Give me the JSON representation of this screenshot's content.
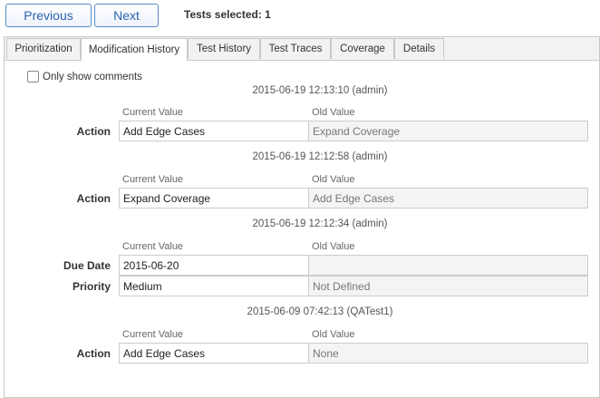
{
  "toolbar": {
    "previous_label": "Previous",
    "next_label": "Next",
    "selected_text": "Tests selected: 1"
  },
  "tabs": [
    {
      "label": "Prioritization",
      "active": false
    },
    {
      "label": "Modification History",
      "active": true
    },
    {
      "label": "Test History",
      "active": false
    },
    {
      "label": "Test Traces",
      "active": false
    },
    {
      "label": "Coverage",
      "active": false
    },
    {
      "label": "Details",
      "active": false
    }
  ],
  "filter": {
    "only_comments_label": "Only show comments",
    "checked": false
  },
  "columns": {
    "current": "Current Value",
    "old": "Old Value"
  },
  "entries": [
    {
      "timestamp": "2015-06-19 12:13:10 (admin)",
      "rows": [
        {
          "field": "Action",
          "current": "Add Edge Cases",
          "old": "Expand Coverage"
        }
      ]
    },
    {
      "timestamp": "2015-06-19 12:12:58 (admin)",
      "rows": [
        {
          "field": "Action",
          "current": "Expand Coverage",
          "old": "Add Edge Cases"
        }
      ]
    },
    {
      "timestamp": "2015-06-19 12:12:34 (admin)",
      "rows": [
        {
          "field": "Due Date",
          "current": "2015-06-20",
          "old": ""
        },
        {
          "field": "Priority",
          "current": "Medium",
          "old": "Not Defined"
        }
      ]
    },
    {
      "timestamp": "2015-06-09 07:42:13 (QATest1)",
      "rows": [
        {
          "field": "Action",
          "current": "Add Edge Cases",
          "old": "None"
        }
      ]
    }
  ]
}
